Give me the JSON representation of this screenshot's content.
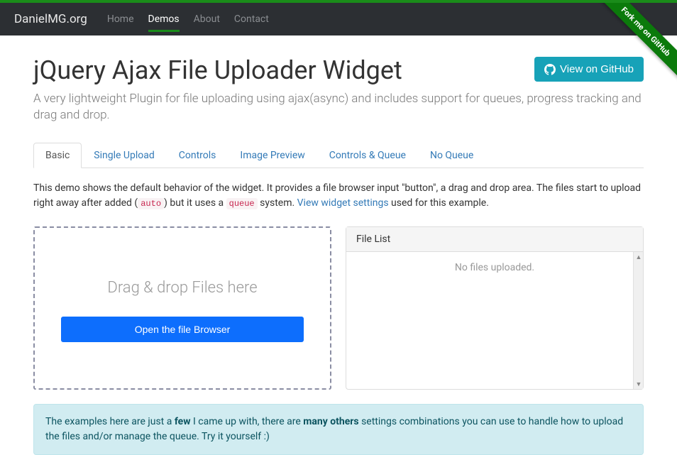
{
  "brand": "DanielMG.org",
  "nav": {
    "items": [
      {
        "label": "Home"
      },
      {
        "label": "Demos"
      },
      {
        "label": "About"
      },
      {
        "label": "Contact"
      }
    ],
    "active_index": 1
  },
  "fork_ribbon": "Fork me on GitHub",
  "page_title": "jQuery Ajax File Uploader Widget",
  "github_button": "View on GitHub",
  "subtitle": "A very lightweight Plugin for file uploading using ajax(async) and includes support for queues, progress tracking and drag and drop.",
  "tabs": [
    {
      "label": "Basic"
    },
    {
      "label": "Single Upload"
    },
    {
      "label": "Controls"
    },
    {
      "label": "Image Preview"
    },
    {
      "label": "Controls & Queue"
    },
    {
      "label": "No Queue"
    }
  ],
  "active_tab_index": 0,
  "desc": {
    "p1": "This demo shows the default behavior of the widget. It provides a file browser input \"button\", a drag and drop area. The files start to upload right away after added (",
    "code1": "auto",
    "p2": ") but it uses a ",
    "code2": "queue",
    "p3": " system. ",
    "link": "View widget settings",
    "p4": " used for this example."
  },
  "dropzone": {
    "text": "Drag & drop Files here",
    "button": "Open the file Browser"
  },
  "file_list": {
    "header": "File List",
    "empty": "No files uploaded."
  },
  "alert": {
    "p1": "The examples here are just a ",
    "b1": "few",
    "p2": " I came up with, there are ",
    "b2": "many others",
    "p3": " settings combinations you can use to handle how to upload the files and/or manage the queue. Try it yourself :)"
  }
}
